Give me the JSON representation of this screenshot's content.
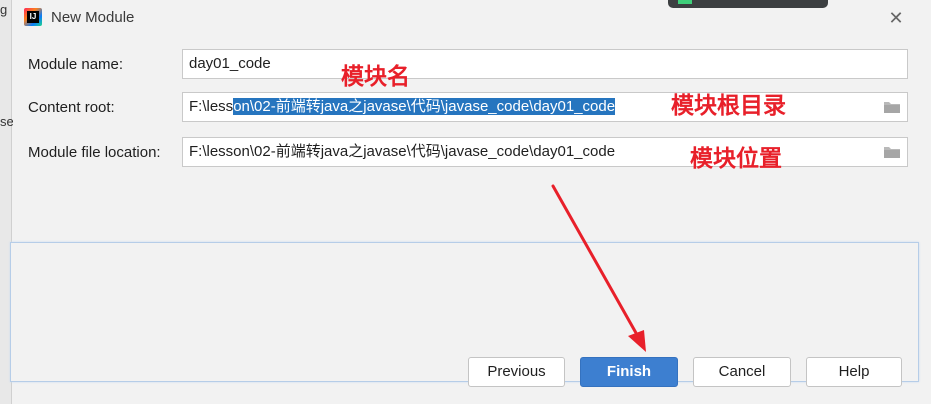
{
  "window": {
    "title": "New Module",
    "app_icon_text": "IJ",
    "close_symbol": "✕"
  },
  "background": {
    "fragment_top": "g",
    "fragment_mid": "se"
  },
  "form": {
    "module_name": {
      "label": "Module name:",
      "value": "day01_code"
    },
    "content_root": {
      "label": "Content root:",
      "value_unselected": "F:\\less",
      "value_selected": "on\\02-前端转java之javase\\代码\\javase_code\\day01_code"
    },
    "module_file_location": {
      "label": "Module file location:",
      "value": "F:\\lesson\\02-前端转java之javase\\代码\\javase_code\\day01_code"
    }
  },
  "annotations": {
    "module_name": "模块名",
    "content_root": "模块根目录",
    "module_location": "模块位置"
  },
  "buttons": {
    "previous": "Previous",
    "finish": "Finish",
    "cancel": "Cancel",
    "help": "Help"
  },
  "colors": {
    "accent": "#3d7fd0",
    "selection": "#2675bf",
    "annotation": "#e8202a",
    "folder_icon": "folder-icon"
  }
}
